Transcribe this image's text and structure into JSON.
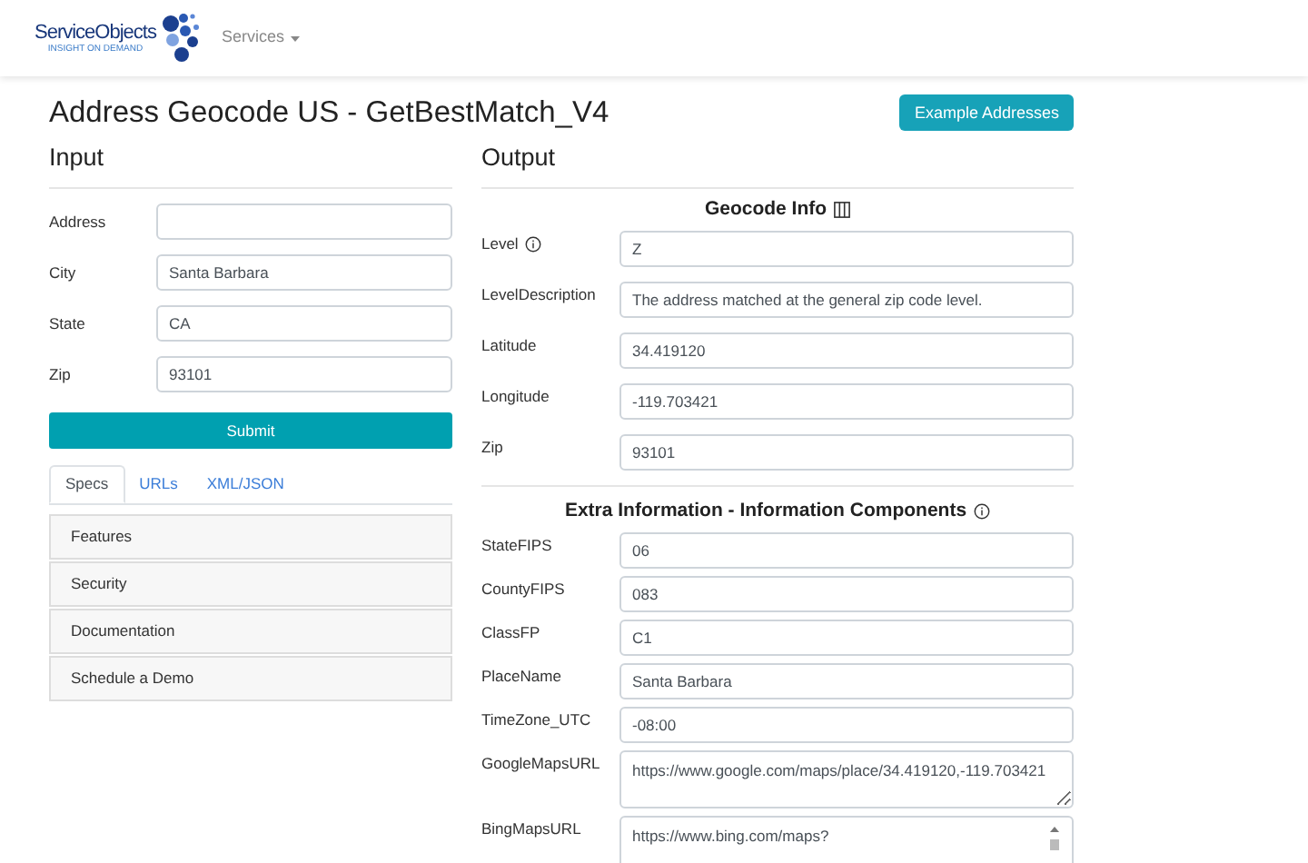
{
  "header": {
    "logo": {
      "name": "ServiceObjects",
      "tagline": "INSIGHT ON DEMAND"
    },
    "nav": [
      {
        "label": "Services"
      }
    ]
  },
  "page": {
    "title": "Address Geocode US - GetBestMatch_V4",
    "action": "Example Addresses"
  },
  "input": {
    "heading": "Input",
    "fields": [
      {
        "label": "Address"
      },
      {
        "label": "City",
        "value": "Santa Barbara"
      },
      {
        "label": "State",
        "value": "CA"
      },
      {
        "label": "Zip",
        "value": "93101"
      }
    ],
    "submit": "Submit",
    "tabs": [
      {
        "label": "Specs",
        "selected": true
      },
      {
        "label": "URLs",
        "selected": false
      },
      {
        "label": "XML/JSON",
        "selected": false
      }
    ],
    "accordion": [
      "Features",
      "Security",
      "Documentation",
      "Schedule a Demo"
    ]
  },
  "output": {
    "heading": "Output",
    "sections": [
      {
        "title": "Geocode Info",
        "fields": [
          {
            "label": "Level",
            "value": "Z",
            "kind": "input",
            "info": true
          },
          {
            "label": "LevelDescription",
            "value": "The address matched at the general zip code level.",
            "kind": "input",
            "info": false
          },
          {
            "label": "Latitude",
            "value": "34.419120",
            "kind": "input",
            "info": false
          },
          {
            "label": "Longitude",
            "value": "-119.703421",
            "kind": "input",
            "info": false
          },
          {
            "label": "Zip",
            "value": "93101",
            "kind": "input",
            "info": false
          }
        ]
      },
      {
        "title": "Extra Information - Information Components",
        "fields": [
          {
            "label": "StateFIPS",
            "value": "06",
            "kind": "input",
            "info": false
          },
          {
            "label": "CountyFIPS",
            "value": "083",
            "kind": "input",
            "info": false
          },
          {
            "label": "ClassFP",
            "value": "C1",
            "kind": "input",
            "info": false
          },
          {
            "label": "PlaceName",
            "value": "Santa Barbara",
            "kind": "input",
            "info": false
          },
          {
            "label": "TimeZone_UTC",
            "value": "-08:00",
            "kind": "input",
            "info": false
          },
          {
            "label": "GoogleMapsURL",
            "value": "https://www.google.com/maps/place/34.419120,-119.703421",
            "kind": "textarea",
            "info": false
          },
          {
            "label": "BingMapsURL",
            "value": "https://www.bing.com/maps?",
            "kind": "scrollarea",
            "info": false
          }
        ]
      }
    ]
  }
}
